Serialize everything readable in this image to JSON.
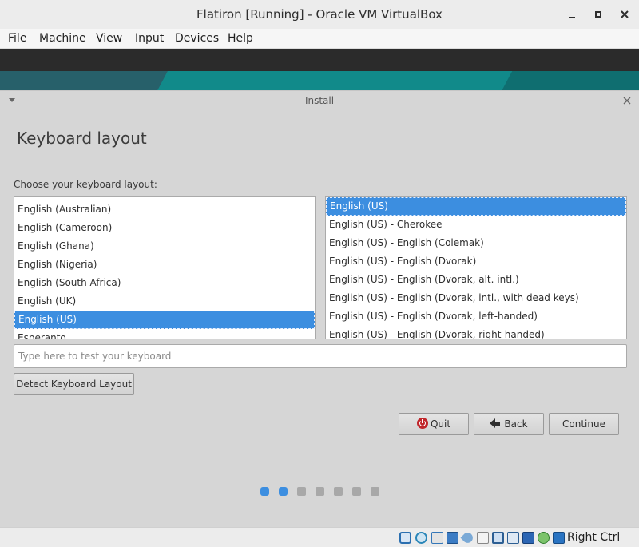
{
  "window": {
    "title": "Flatiron [Running] - Oracle VM VirtualBox"
  },
  "menubar": [
    "File",
    "Machine",
    "View",
    "Input",
    "Devices",
    "Help"
  ],
  "dialog": {
    "title": "Install",
    "heading": "Keyboard layout",
    "choose_label": "Choose your keyboard layout:",
    "layouts": [
      "English (Australian)",
      "English (Cameroon)",
      "English (Ghana)",
      "English (Nigeria)",
      "English (South Africa)",
      "English (UK)",
      "English (US)",
      "Esperanto"
    ],
    "selected_layout": "English (US)",
    "variants": [
      "English (US)",
      "English (US) - Cherokee",
      "English (US) - English (Colemak)",
      "English (US) - English (Dvorak)",
      "English (US) - English (Dvorak, alt. intl.)",
      "English (US) - English (Dvorak, intl., with dead keys)",
      "English (US) - English (Dvorak, left-handed)",
      "English (US) - English (Dvorak, right-handed)"
    ],
    "selected_variant": "English (US)",
    "test_placeholder": "Type here to test your keyboard",
    "detect_label": "Detect Keyboard Layout",
    "quit_label": "Quit",
    "back_label": "Back",
    "continue_label": "Continue",
    "progress": {
      "current_step": 2,
      "total_steps": 7
    }
  },
  "statusbar": {
    "host_key": "Right Ctrl",
    "icons": [
      "hard-disk-icon",
      "optical-drive-icon",
      "audio-icon",
      "network-icon",
      "usb-icon",
      "shared-folders-icon",
      "display-icon",
      "video-capture-icon",
      "recording-icon",
      "cpu-icon",
      "mouse-integration-icon",
      "keyboard-capture-icon"
    ]
  }
}
